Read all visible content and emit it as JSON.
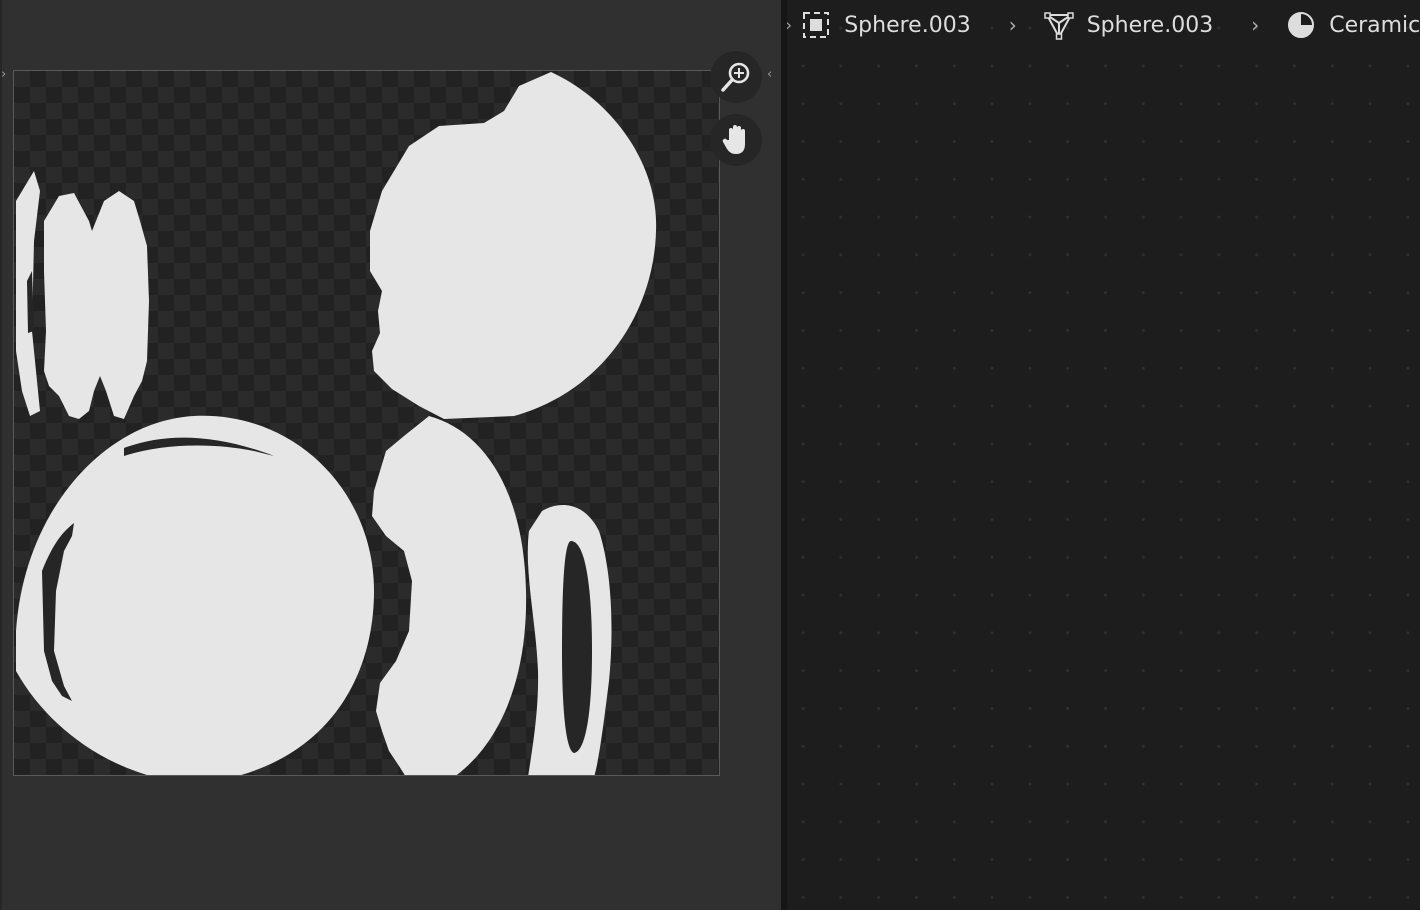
{
  "image_editor": {
    "tools": [
      {
        "name": "zoom",
        "icon": "zoom-in-icon"
      },
      {
        "name": "pan",
        "icon": "hand-icon"
      }
    ]
  },
  "node_editor": {
    "breadcrumb": [
      {
        "icon": "object-icon",
        "label": "Sphere.003"
      },
      {
        "icon": "mesh-icon",
        "label": "Sphere.003"
      },
      {
        "icon": "material-icon",
        "label": "Ceramic"
      }
    ]
  },
  "colors": {
    "panel_bg": "#303030",
    "node_bg": "#1d1d1d",
    "uv_fill": "#e6e6e6"
  }
}
